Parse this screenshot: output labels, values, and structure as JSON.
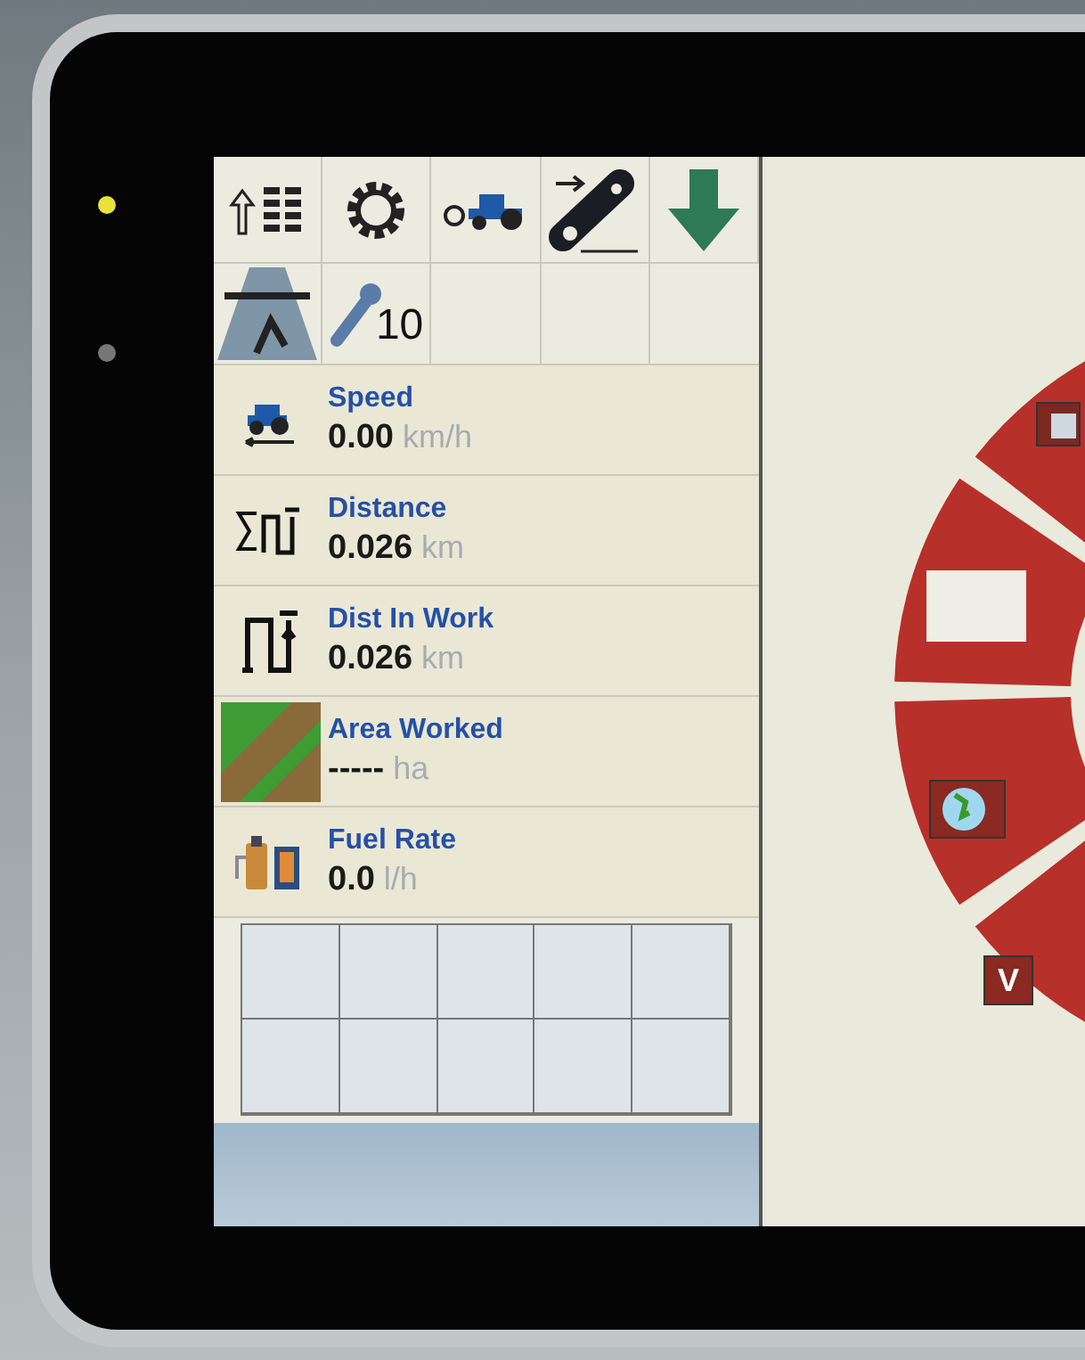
{
  "toolbar": {
    "service_count": "10"
  },
  "readouts": [
    {
      "kind": "speed",
      "label": "Speed",
      "value": "0.00",
      "unit": "km/h"
    },
    {
      "kind": "distance",
      "label": "Distance",
      "value": "0.026",
      "unit": "km"
    },
    {
      "kind": "work_distance",
      "label": "Dist In Work",
      "value": "0.026",
      "unit": "km"
    },
    {
      "kind": "area",
      "label": "Area Worked",
      "value": "-----",
      "unit": "ha"
    },
    {
      "kind": "fuel",
      "label": "Fuel Rate",
      "value": "0.0",
      "unit": "l/h"
    }
  ],
  "ring_menu": {
    "segments": [
      {
        "kind": "screen"
      },
      {
        "kind": "blank"
      },
      {
        "kind": "globe"
      },
      {
        "kind": "letter",
        "text": "V"
      }
    ]
  }
}
